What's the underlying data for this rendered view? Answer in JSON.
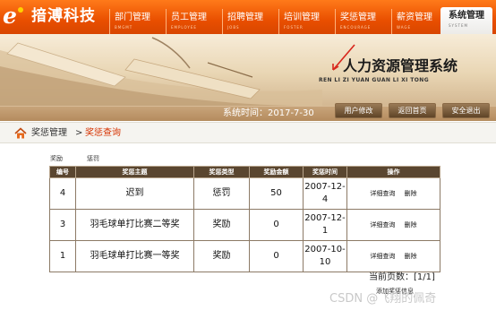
{
  "header": {
    "logo_text": "揞溥科技",
    "nav": [
      {
        "cn": "部门管理",
        "en": "BMGMT",
        "active": false
      },
      {
        "cn": "员工管理",
        "en": "EMPLOYEE",
        "active": false
      },
      {
        "cn": "招聘管理",
        "en": "JOBS",
        "active": false
      },
      {
        "cn": "培训管理",
        "en": "FOSTER",
        "active": false
      },
      {
        "cn": "奖惩管理",
        "en": "ENCOURAGE",
        "active": false
      },
      {
        "cn": "薪资管理",
        "en": "WAGE",
        "active": false
      },
      {
        "cn": "系统管理",
        "en": "SYSTEM",
        "active": true
      }
    ]
  },
  "banner": {
    "title": "人力资源管理系统",
    "subtitle": "REN LI ZI YUAN GUAN LI XI TONG",
    "system_time": "系统时间：2017-7-30",
    "buttons": [
      "用户修改",
      "返回首页",
      "安全退出"
    ]
  },
  "breadcrumb": {
    "section": "奖惩管理",
    "separator": ">",
    "current": "奖惩查询"
  },
  "filters": [
    "奖励",
    "惩罚"
  ],
  "table": {
    "headers": [
      "编号",
      "奖惩主题",
      "奖惩类型",
      "奖励金额",
      "奖惩时间",
      "操作"
    ],
    "rows": [
      {
        "id": "4",
        "topic": "迟到",
        "type": "惩罚",
        "amount": "50",
        "time": "2007-12-4"
      },
      {
        "id": "3",
        "topic": "羽毛球单打比赛二等奖",
        "type": "奖励",
        "amount": "0",
        "time": "2007-12-1"
      },
      {
        "id": "1",
        "topic": "羽毛球单打比赛一等奖",
        "type": "奖励",
        "amount": "0",
        "time": "2007-10-10"
      }
    ],
    "action_detail": "详细查询",
    "action_delete": "删除"
  },
  "pagination": "当前页数：[1/1]",
  "add_link": "添加奖惩信息",
  "watermark": "CSDN @飞翔的佩奇",
  "colors": {
    "header_orange": "#e94f00",
    "table_header": "#5a4630",
    "crumb_current": "#d63200"
  }
}
